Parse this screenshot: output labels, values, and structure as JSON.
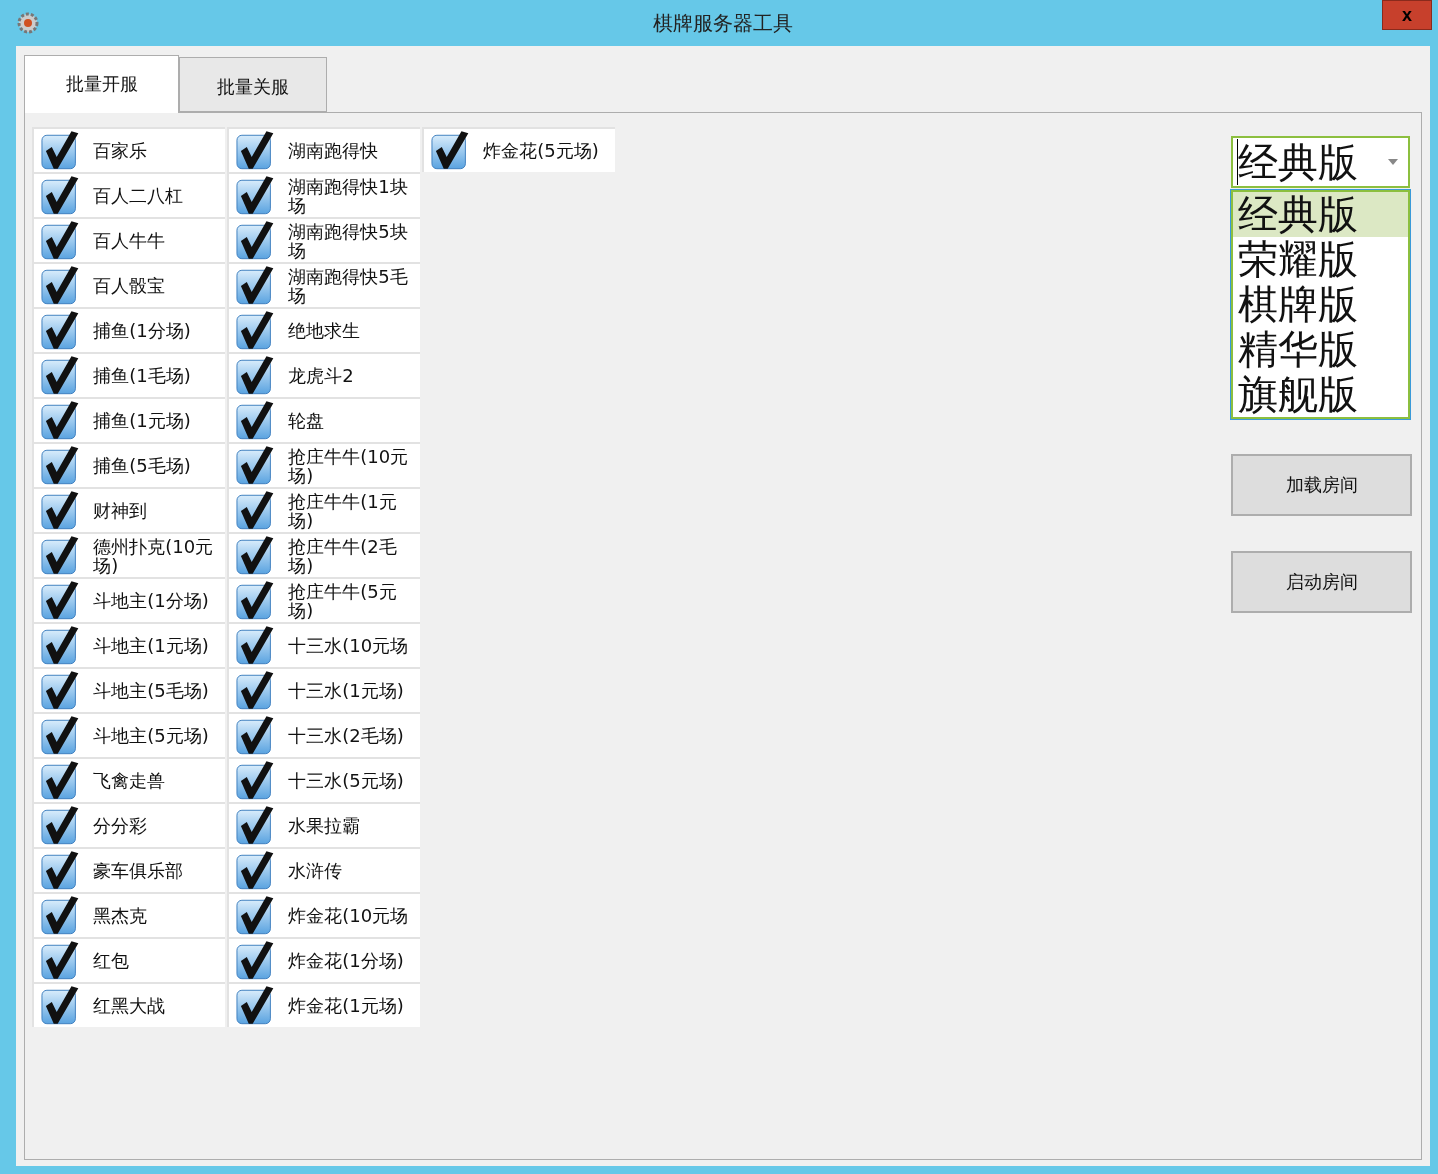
{
  "window": {
    "title": "棋牌服务器工具",
    "close": "x"
  },
  "tabs": [
    {
      "label": "批量开服",
      "selected": true
    },
    {
      "label": "批量关服",
      "selected": false
    }
  ],
  "columns": [
    [
      {
        "label": "百家乐",
        "checked": true
      },
      {
        "label": "百人二八杠",
        "checked": true
      },
      {
        "label": "百人牛牛",
        "checked": true
      },
      {
        "label": "百人骰宝",
        "checked": true
      },
      {
        "label": "捕鱼(1分场)",
        "checked": true
      },
      {
        "label": "捕鱼(1毛场)",
        "checked": true
      },
      {
        "label": "捕鱼(1元场)",
        "checked": true
      },
      {
        "label": "捕鱼(5毛场)",
        "checked": true
      },
      {
        "label": "财神到",
        "checked": true
      },
      {
        "label": "德州扑克(10元场)",
        "checked": true
      },
      {
        "label": "斗地主(1分场)",
        "checked": true
      },
      {
        "label": "斗地主(1元场)",
        "checked": true
      },
      {
        "label": "斗地主(5毛场)",
        "checked": true
      },
      {
        "label": "斗地主(5元场)",
        "checked": true
      },
      {
        "label": "飞禽走兽",
        "checked": true
      },
      {
        "label": "分分彩",
        "checked": true
      },
      {
        "label": "豪车俱乐部",
        "checked": true
      },
      {
        "label": "黑杰克",
        "checked": true
      },
      {
        "label": "红包",
        "checked": true
      },
      {
        "label": "红黑大战",
        "checked": true
      }
    ],
    [
      {
        "label": "湖南跑得快",
        "checked": true
      },
      {
        "label": "湖南跑得快1块场",
        "checked": true
      },
      {
        "label": "湖南跑得快5块场",
        "checked": true
      },
      {
        "label": "湖南跑得快5毛场",
        "checked": true
      },
      {
        "label": "绝地求生",
        "checked": true
      },
      {
        "label": "龙虎斗2",
        "checked": true
      },
      {
        "label": "轮盘",
        "checked": true
      },
      {
        "label": "抢庄牛牛(10元场)",
        "checked": true
      },
      {
        "label": "抢庄牛牛(1元场)",
        "checked": true
      },
      {
        "label": "抢庄牛牛(2毛场)",
        "checked": true
      },
      {
        "label": "抢庄牛牛(5元场)",
        "checked": true
      },
      {
        "label": "十三水(10元场",
        "checked": true
      },
      {
        "label": "十三水(1元场)",
        "checked": true
      },
      {
        "label": "十三水(2毛场)",
        "checked": true
      },
      {
        "label": "十三水(5元场)",
        "checked": true
      },
      {
        "label": "水果拉霸",
        "checked": true
      },
      {
        "label": "水浒传",
        "checked": true
      },
      {
        "label": "炸金花(10元场",
        "checked": true
      },
      {
        "label": "炸金花(1分场)",
        "checked": true
      },
      {
        "label": "炸金花(1元场)",
        "checked": true
      }
    ],
    [
      {
        "label": "炸金花(5元场)",
        "checked": true
      }
    ]
  ],
  "version_select": {
    "value": "经典版",
    "options": [
      {
        "label": "经典版",
        "selected": true
      },
      {
        "label": "荣耀版",
        "selected": false
      },
      {
        "label": "棋牌版",
        "selected": false
      },
      {
        "label": "精华版",
        "selected": false
      },
      {
        "label": "旗舰版",
        "selected": false
      }
    ]
  },
  "buttons": [
    "加载房间",
    "启动房间"
  ]
}
